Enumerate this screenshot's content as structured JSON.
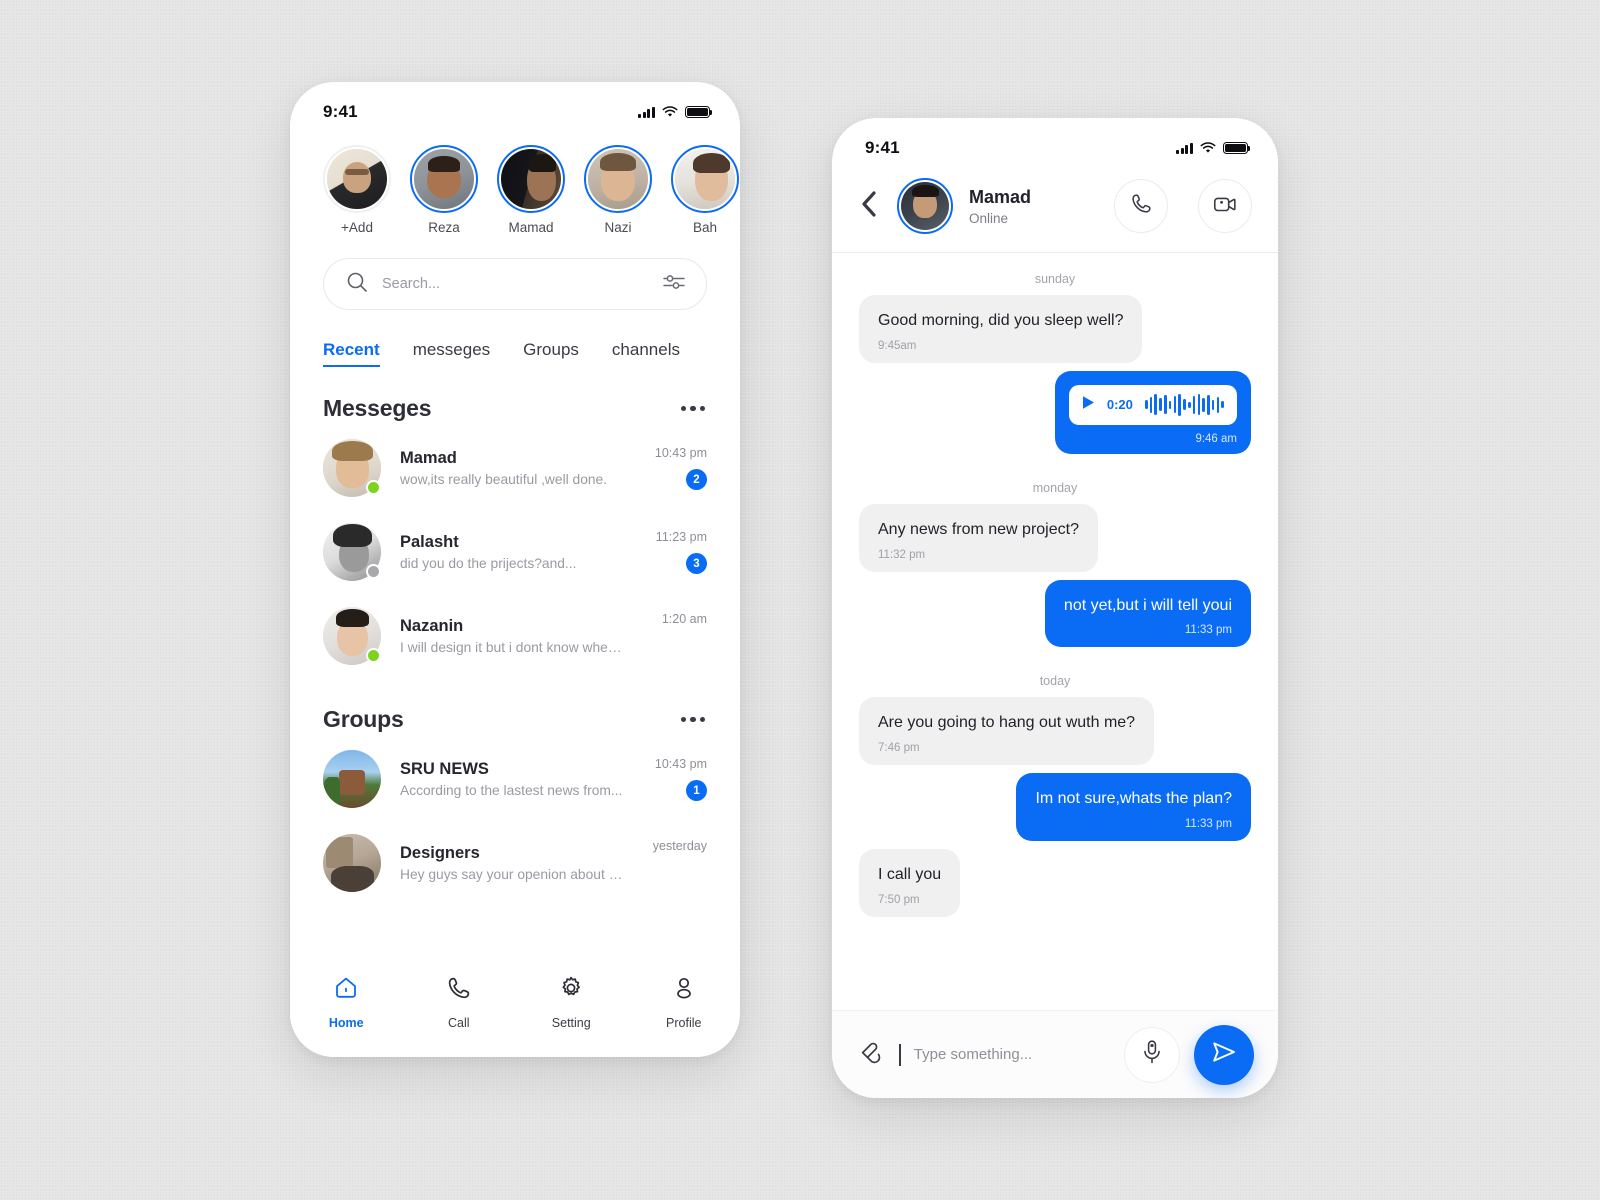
{
  "background": {
    "color": "#e5e5e5"
  },
  "theme": {
    "accent": "#0a6cf5",
    "bubble_in": "#f0f0f0",
    "online_dot": "#7ed321"
  },
  "left_phone": {
    "statusbar": {
      "time": "9:41",
      "signal_icon": "cellular-bars-icon",
      "wifi_icon": "wifi-icon",
      "battery_icon": "battery-full-icon"
    },
    "stories": [
      {
        "name": "+Add",
        "ring": "plain",
        "photo": "ph-a"
      },
      {
        "name": "Reza",
        "ring": "active",
        "photo": "ph-b"
      },
      {
        "name": "Mamad",
        "ring": "active",
        "photo": "ph-c"
      },
      {
        "name": "Nazi",
        "ring": "active",
        "photo": "ph-d"
      },
      {
        "name": "Bah",
        "ring": "active",
        "photo": "ph-e"
      }
    ],
    "search": {
      "placeholder": "Search...",
      "icon": "search-icon",
      "filter_icon": "filter-sliders-icon"
    },
    "tabs": [
      {
        "label": "Recent",
        "active": true
      },
      {
        "label": "messeges",
        "active": false
      },
      {
        "label": "Groups",
        "active": false
      },
      {
        "label": "channels",
        "active": false
      }
    ],
    "sections": [
      {
        "title": "Messeges",
        "menu_icon": "more-horizontal-icon",
        "rows": [
          {
            "name": "Mamad",
            "preview": "wow,its really beautiful ,well done.",
            "time": "10:43 pm",
            "badge": "2",
            "presence": "online",
            "photo": "ph-f"
          },
          {
            "name": "Palasht",
            "preview": "did you do the prijects?and...",
            "time": "11:23 pm",
            "badge": "3",
            "presence": "offline",
            "photo": "ph-g"
          },
          {
            "name": "Nazanin",
            "preview": "I will design it but i dont know when and...",
            "time": "1:20 am",
            "badge": "",
            "presence": "online",
            "photo": "ph-h"
          }
        ]
      },
      {
        "title": "Groups",
        "menu_icon": "more-horizontal-icon",
        "rows": [
          {
            "name": "SRU NEWS",
            "preview": "According to the lastest news from...",
            "time": "10:43 pm",
            "badge": "1",
            "presence": "",
            "photo": "ph-i"
          },
          {
            "name": "Designers",
            "preview": "Hey guys say your openion about my....",
            "time": "yesterday",
            "badge": "",
            "presence": "",
            "photo": "ph-j"
          }
        ]
      }
    ],
    "bottom_nav": [
      {
        "label": "Home",
        "icon": "home-icon",
        "active": true
      },
      {
        "label": "Call",
        "icon": "phone-icon",
        "active": false
      },
      {
        "label": "Setting",
        "icon": "gear-icon",
        "active": false
      },
      {
        "label": "Profile",
        "icon": "person-icon",
        "active": false
      }
    ]
  },
  "right_phone": {
    "statusbar": {
      "time": "9:41",
      "signal_icon": "cellular-bars-icon",
      "wifi_icon": "wifi-icon",
      "battery_icon": "battery-full-icon"
    },
    "header": {
      "back_icon": "chevron-left-icon",
      "name": "Mamad",
      "status": "Online",
      "call_icon": "phone-icon",
      "video_icon": "video-camera-icon"
    },
    "conversation": [
      {
        "kind": "day",
        "text": "sunday"
      },
      {
        "kind": "text",
        "side": "in",
        "text": "Good morning, did you sleep well?",
        "time": "9:45am"
      },
      {
        "kind": "voice",
        "side": "out",
        "duration": "0:20",
        "time": "9:46 am",
        "play_icon": "play-icon",
        "waveform_icon": "audio-waveform-icon"
      },
      {
        "kind": "day",
        "text": "monday"
      },
      {
        "kind": "text",
        "side": "in",
        "text": "Any news from new project?",
        "time": "11:32 pm"
      },
      {
        "kind": "text",
        "side": "out",
        "text": "not yet,but i will tell youi",
        "time": "11:33 pm"
      },
      {
        "kind": "day",
        "text": "today"
      },
      {
        "kind": "text",
        "side": "in",
        "text": "Are you going to hang out wuth me?",
        "time": "7:46 pm"
      },
      {
        "kind": "text",
        "side": "out",
        "text": "Im not sure,whats the plan?",
        "time": "11:33 pm"
      },
      {
        "kind": "text",
        "side": "in",
        "text": "I call you",
        "time": "7:50 pm"
      }
    ],
    "composer": {
      "attach_icon": "paperclip-icon",
      "placeholder": "Type something...",
      "mic_icon": "microphone-icon",
      "send_icon": "send-icon"
    }
  }
}
